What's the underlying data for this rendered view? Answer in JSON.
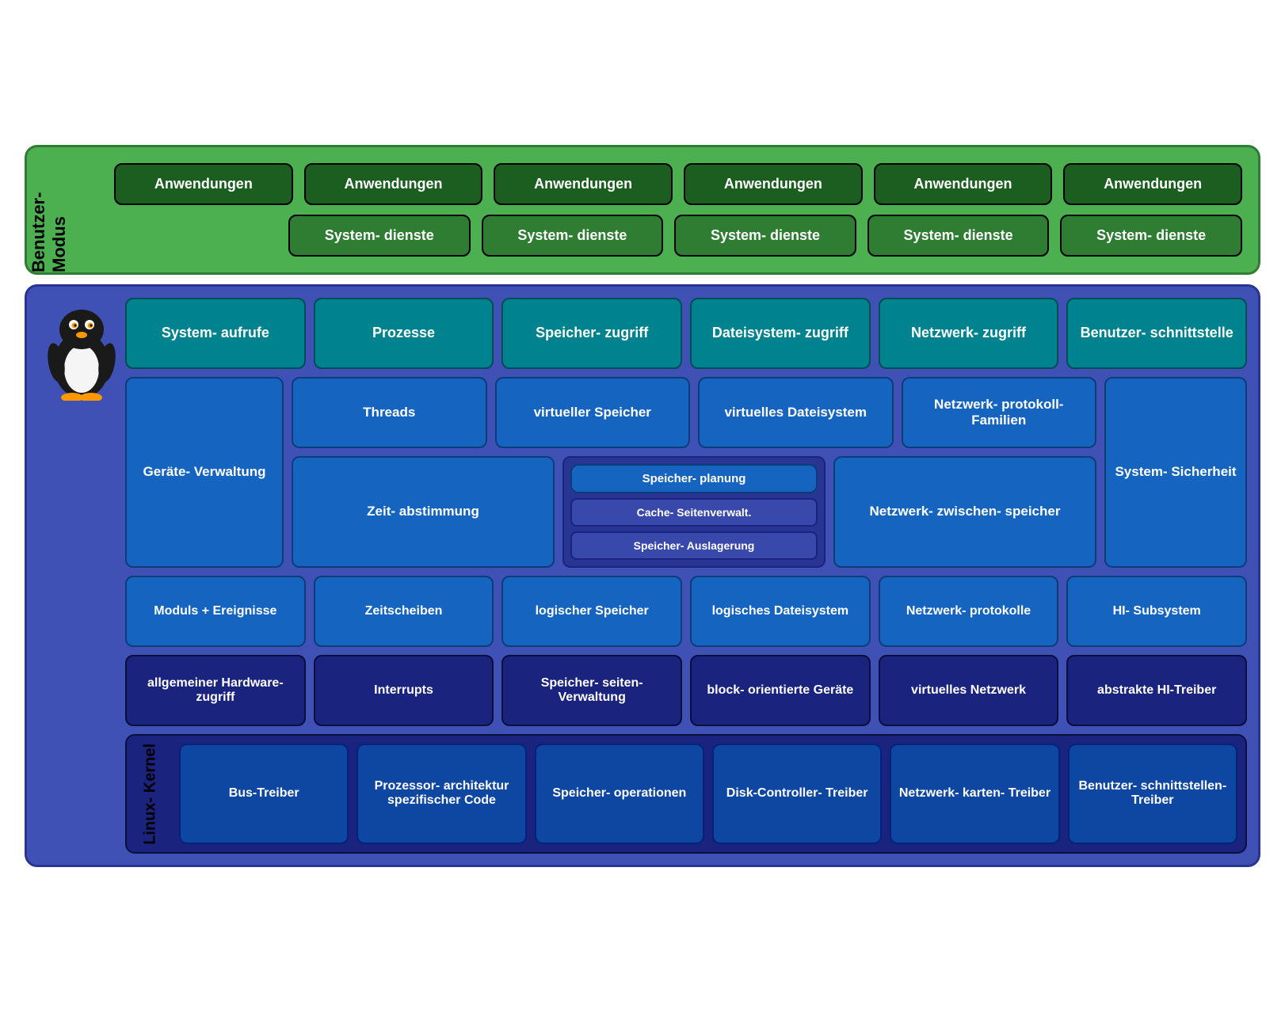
{
  "benutzer_modus": {
    "label": "Benutzer-\nModus",
    "row1": [
      "Anwendungen",
      "Anwendungen",
      "Anwendungen",
      "Anwendungen",
      "Anwendungen",
      "Anwendungen"
    ],
    "row2": [
      "System-\ndienste",
      "System-\ndienste",
      "System-\ndienste",
      "System-\ndienste",
      "System-\ndienste"
    ]
  },
  "kernel": {
    "label": "Linux-\nKernel",
    "row1": {
      "items": [
        {
          "text": "System-\naufrufe",
          "color": "teal"
        },
        {
          "text": "Prozesse",
          "color": "teal"
        },
        {
          "text": "Speicher-\nzugriff",
          "color": "teal"
        },
        {
          "text": "Dateisystem-\nzugriff",
          "color": "teal"
        },
        {
          "text": "Netzwerk-\nzugriff",
          "color": "teal"
        },
        {
          "text": "Benutzer-\nschnittstelle",
          "color": "teal"
        }
      ]
    },
    "geraete": "Geräte-\nVerwaltung",
    "system_sicherheit": "System-\nSicherheit",
    "threads": "Threads",
    "virtueller_speicher": "virtueller\nSpeicher",
    "virtuelles_dateisystem": "virtuelles\nDateisystem",
    "netzwerk_protokoll_familien": "Netzwerk-\nprotokoll-\nFamilien",
    "zeitabstimmung": "Zeit-\nabstimmung",
    "speicherplanung": "Speicher-\nplanung",
    "cache_seitenverwalt": "Cache-\nSeitenverwalt.",
    "speicher_auslagerung": "Speicher-\nAuslagerung",
    "netzwerk_zwischenspeicher": "Netzwerk-\nzwischen-\nspeicher",
    "row4_items": [
      {
        "text": "Moduls\n+\nEreignisse"
      },
      {
        "text": "Zeitscheiben"
      },
      {
        "text": "logischer\nSpeicher"
      },
      {
        "text": "logisches\nDateisystem"
      },
      {
        "text": "Netzwerk-\nprotokolle"
      },
      {
        "text": "HI-\nSubsystem"
      }
    ],
    "row5_items": [
      {
        "text": "allgemeiner\nHardware-\nzugriff"
      },
      {
        "text": "Interrupts"
      },
      {
        "text": "Speicher-\nseiten-\nVerwaltung"
      },
      {
        "text": "block-\norientierte\nGeräte"
      },
      {
        "text": "virtuelles\nNetzwerk"
      },
      {
        "text": "abstrakte\nHI-Treiber"
      }
    ],
    "row6_items": [
      {
        "text": "Bus-Treiber"
      },
      {
        "text": "Prozessor-\narchitektur\nspezifischer\nCode"
      },
      {
        "text": "Speicher-\noperationen"
      },
      {
        "text": "Disk-Controller-\nTreiber"
      },
      {
        "text": "Netzwerk-\nkarten-\nTreiber"
      },
      {
        "text": "Benutzer-\nschnittstellen-\nTreiber"
      }
    ]
  }
}
